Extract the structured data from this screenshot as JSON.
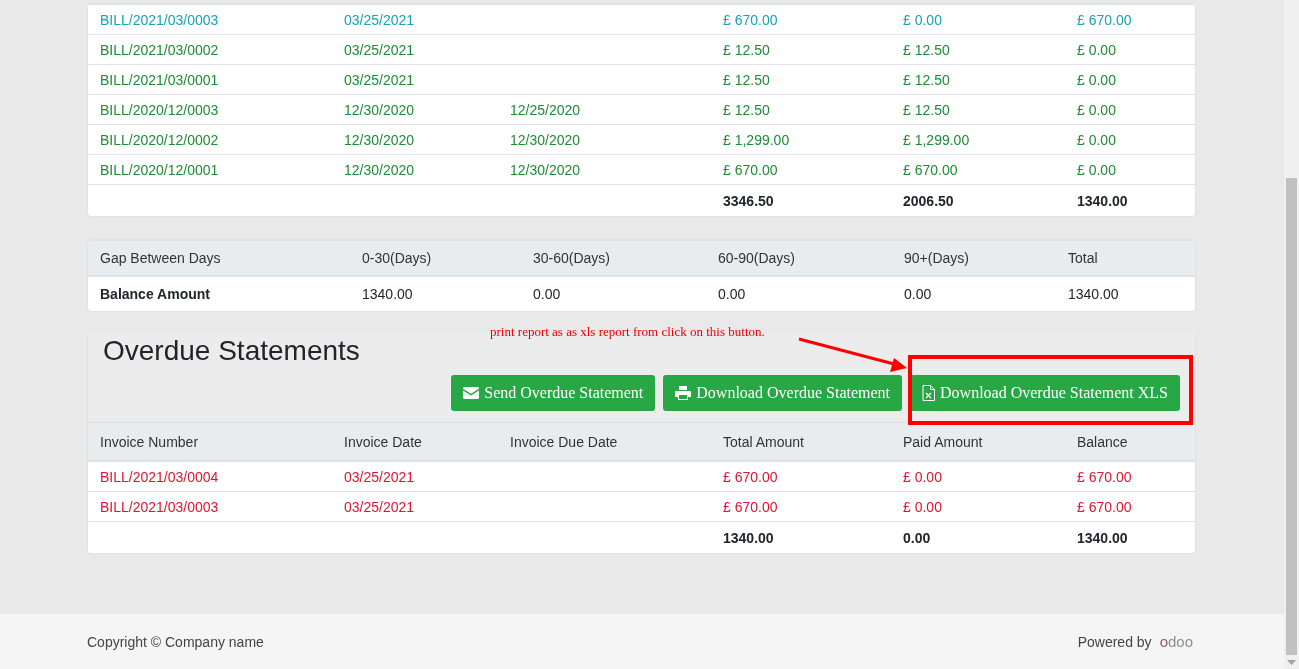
{
  "bills_table": {
    "rows": [
      {
        "color": "#17a2b8",
        "invoice_number": "BILL/2021/03/0003",
        "invoice_date": "03/25/2021",
        "total": "£ 670.00",
        "paid": "£ 0.00",
        "balance": "£ 670.00"
      },
      {
        "color": "#1e8c34",
        "invoice_number": "BILL/2021/03/0002",
        "invoice_date": "03/25/2021",
        "total": "£ 12.50",
        "paid": "£ 12.50",
        "balance": "£ 0.00"
      },
      {
        "color": "#1e8c34",
        "invoice_number": "BILL/2021/03/0001",
        "invoice_date": "03/25/2021",
        "total": "£ 12.50",
        "paid": "£ 12.50",
        "balance": "£ 0.00"
      },
      {
        "color": "#1e8c34",
        "invoice_number": "BILL/2020/12/0003",
        "invoice_date": "12/30/2020",
        "due_date": "12/25/2020",
        "total": "£ 12.50",
        "paid": "£ 12.50",
        "balance": "£ 0.00"
      },
      {
        "color": "#1e8c34",
        "invoice_number": "BILL/2020/12/0002",
        "invoice_date": "12/30/2020",
        "due_date": "12/30/2020",
        "total": "£ 1,299.00",
        "paid": "£ 1,299.00",
        "balance": "£ 0.00"
      },
      {
        "color": "#1e8c34",
        "invoice_number": "BILL/2020/12/0001",
        "invoice_date": "12/30/2020",
        "due_date": "12/30/2020",
        "total": "£ 670.00",
        "paid": "£ 670.00",
        "balance": "£ 0.00"
      }
    ],
    "totals": {
      "total": "3346.50",
      "paid": "2006.50",
      "balance": "1340.00"
    }
  },
  "aging_table": {
    "columns": [
      "Gap Between Days",
      "0-30(Days)",
      "30-60(Days)",
      "60-90(Days)",
      "90+(Days)",
      "Total"
    ],
    "rows": [
      {
        "label": "Balance Amount",
        "values": [
          "1340.00",
          "0.00",
          "0.00",
          "0.00",
          "1340.00"
        ]
      }
    ]
  },
  "overdue": {
    "title": "Overdue Statements",
    "annotation": "print report as as xls report from click on this button.",
    "buttons": [
      {
        "label": "Send Overdue Statement",
        "kind": "send",
        "highlighted": false
      },
      {
        "label": "Download Overdue Statement",
        "kind": "print",
        "highlighted": false
      },
      {
        "label": "Download Overdue Statement XLS",
        "kind": "xls",
        "highlighted": true
      }
    ],
    "columns": [
      "Invoice Number",
      "Invoice Date",
      "Invoice Due Date",
      "Total Amount",
      "Paid Amount",
      "Balance"
    ],
    "rows": [
      {
        "color": "#e3132e",
        "invoice_number": "BILL/2021/03/0004",
        "invoice_date": "03/25/2021",
        "total": "£ 670.00",
        "paid": "£ 0.00",
        "balance": "£ 670.00"
      },
      {
        "color": "#e3132e",
        "invoice_number": "BILL/2021/03/0003",
        "invoice_date": "03/25/2021",
        "total": "£ 670.00",
        "paid": "£ 0.00",
        "balance": "£ 670.00"
      }
    ],
    "totals": {
      "total": "1340.00",
      "paid": "0.00",
      "balance": "1340.00"
    }
  },
  "footer": {
    "copyright": "Copyright © Company name",
    "powered_by": "Powered by",
    "logo": "odoo"
  }
}
